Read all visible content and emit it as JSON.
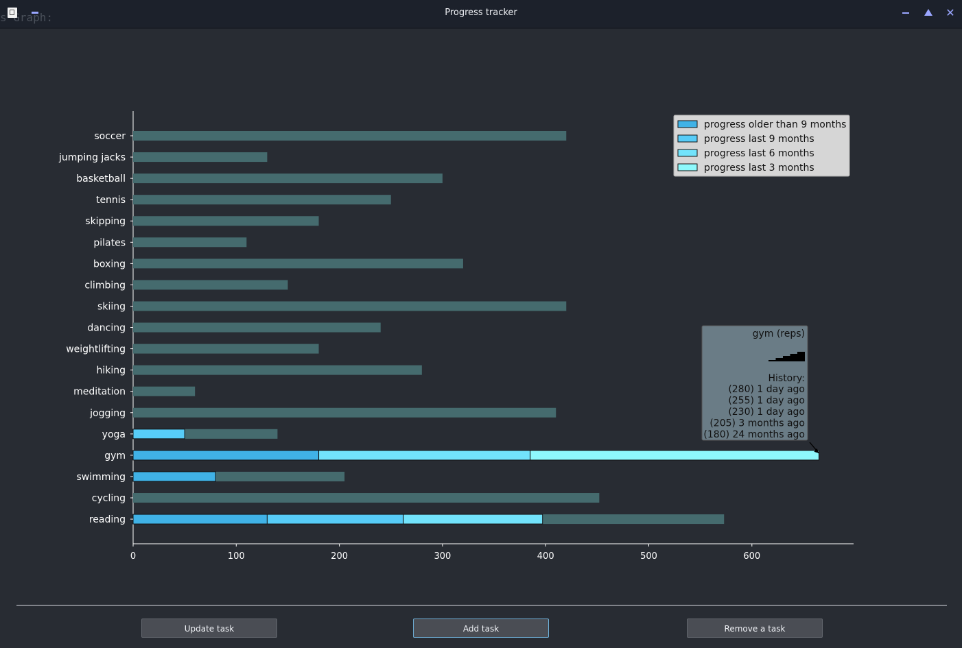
{
  "window": {
    "title": "Progress tracker",
    "background_text": "s Graph:"
  },
  "buttons": {
    "update": "Update task",
    "add": "Add task",
    "remove": "Remove a task"
  },
  "colors": {
    "older_than_9_months": "#40b2e6",
    "last_9_months": "#57ccf7",
    "last_6_months": "#72e3fb",
    "last_3_months": "#8ef9fc",
    "remaining": "#456b6e",
    "tooltip_bg": "#6a7c86",
    "legend_bg": "#d6d6d6"
  },
  "chart_data": {
    "type": "bar",
    "orientation": "horizontal",
    "stacked": true,
    "xlim": [
      0,
      700
    ],
    "xticks": [
      0,
      100,
      200,
      300,
      400,
      500,
      600
    ],
    "grid": false,
    "legend_position": "top-right",
    "legend": [
      "progress older than 9 months",
      "progress last 9 months",
      "progress last 6 months",
      "progress last 3 months"
    ],
    "categories": [
      "soccer",
      "jumping jacks",
      "basketball",
      "tennis",
      "skipping",
      "pilates",
      "boxing",
      "climbing",
      "skiing",
      "dancing",
      "weightlifting",
      "hiking",
      "meditation",
      "jogging",
      "yoga",
      "gym",
      "swimming",
      "cycling",
      "reading"
    ],
    "series": [
      {
        "name": "progress older than 9 months",
        "values": [
          0,
          0,
          0,
          0,
          0,
          0,
          0,
          0,
          0,
          0,
          0,
          0,
          0,
          0,
          0,
          180,
          80,
          0,
          130
        ]
      },
      {
        "name": "progress last 9 months",
        "values": [
          0,
          0,
          0,
          0,
          0,
          0,
          0,
          0,
          0,
          0,
          0,
          0,
          0,
          0,
          50,
          0,
          0,
          0,
          132
        ]
      },
      {
        "name": "progress last 6 months",
        "values": [
          0,
          0,
          0,
          0,
          0,
          0,
          0,
          0,
          0,
          0,
          0,
          0,
          0,
          0,
          0,
          205,
          0,
          0,
          135
        ]
      },
      {
        "name": "progress last 3 months",
        "values": [
          0,
          0,
          0,
          0,
          0,
          0,
          0,
          0,
          0,
          0,
          0,
          0,
          0,
          0,
          0,
          280,
          0,
          0,
          0
        ]
      }
    ],
    "totals": [
      420,
      130,
      300,
      250,
      180,
      110,
      320,
      150,
      420,
      240,
      180,
      280,
      60,
      410,
      140,
      665,
      205,
      452,
      573
    ],
    "tooltip": {
      "task": "gym",
      "title": "gym (reps)",
      "history_label": "History:",
      "history": [
        "(280) 1 day ago",
        "(255) 1 day ago",
        "(230) 1 day ago",
        "(205) 3 months ago",
        "(180) 24 months ago"
      ],
      "sparkline": [
        180,
        205,
        230,
        255,
        280
      ]
    }
  }
}
